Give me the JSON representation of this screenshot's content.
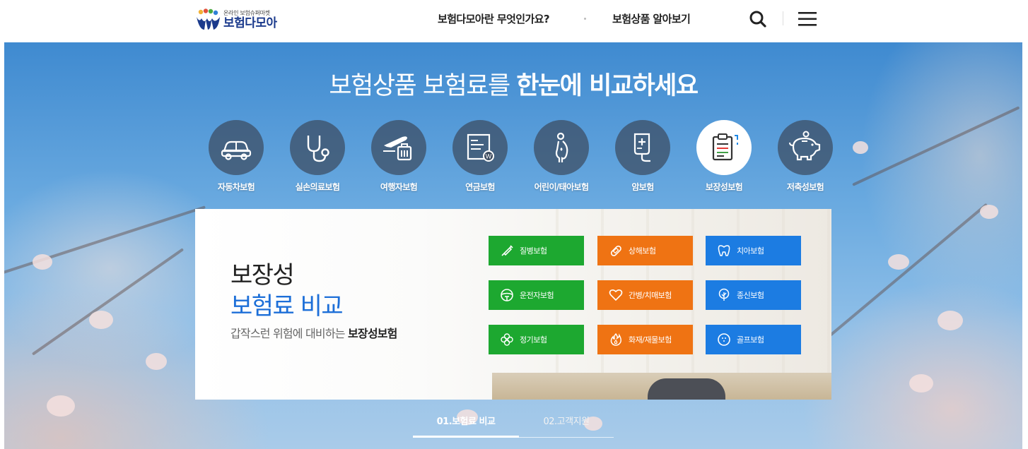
{
  "header": {
    "logo_sub": "온라인 보험슈퍼마켓",
    "logo_main": "보험다모아",
    "nav": [
      {
        "label": "보험다모아란 무엇인가요?"
      },
      {
        "label": "보험상품 알아보기"
      }
    ],
    "icons": {
      "search": "search-icon",
      "menu": "hamburger-menu-icon"
    }
  },
  "hero": {
    "title_light": "보험상품 보험료를 ",
    "title_bold": "한눈에 비교하세요",
    "categories": [
      {
        "label": "자동차보험",
        "icon": "car-icon",
        "active": false
      },
      {
        "label": "실손의료보험",
        "icon": "stethoscope-icon",
        "active": false
      },
      {
        "label": "여행자보험",
        "icon": "airplane-luggage-icon",
        "active": false
      },
      {
        "label": "연금보험",
        "icon": "pension-document-icon",
        "active": false
      },
      {
        "label": "어린이/태아보험",
        "icon": "pregnant-woman-icon",
        "active": false
      },
      {
        "label": "암보험",
        "icon": "iv-bag-icon",
        "active": false
      },
      {
        "label": "보장성보험",
        "icon": "clipboard-icon",
        "active": true
      },
      {
        "label": "저축성보험",
        "icon": "piggy-bank-icon",
        "active": false
      }
    ]
  },
  "panel": {
    "title_line1": "보장성",
    "title_line2": "보험료 비교",
    "desc_light": "갑작스런 위험에 대비하는 ",
    "desc_bold": "보장성보험",
    "sub_products": [
      {
        "label": "질병보험",
        "icon": "syringe-icon",
        "color": "#1da830"
      },
      {
        "label": "상해보험",
        "icon": "bandage-icon",
        "color": "#ef7313"
      },
      {
        "label": "치아보험",
        "icon": "tooth-icon",
        "color": "#1c7ce2"
      },
      {
        "label": "운전자보험",
        "icon": "steering-wheel-icon",
        "color": "#1da830"
      },
      {
        "label": "간병/치매보험",
        "icon": "heart-icon",
        "color": "#ef7313"
      },
      {
        "label": "종신보험",
        "icon": "tree-icon",
        "color": "#1c7ce2"
      },
      {
        "label": "정기보험",
        "icon": "clover-icon",
        "color": "#1da830"
      },
      {
        "label": "화재/재물보험",
        "icon": "fire-icon",
        "color": "#ef7313"
      },
      {
        "label": "골프보험",
        "icon": "golf-ball-icon",
        "color": "#1c7ce2"
      }
    ]
  },
  "tabs": [
    {
      "label": "01.보험료 비교",
      "active": true
    },
    {
      "label": "02.고객지원",
      "active": false
    }
  ]
}
